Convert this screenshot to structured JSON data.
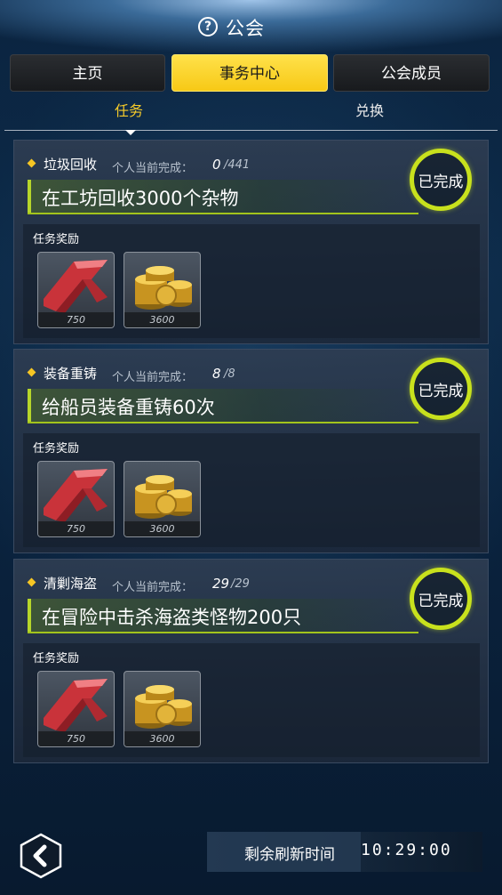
{
  "header": {
    "title": "公会",
    "help_symbol": "?"
  },
  "tabs": [
    {
      "label": "主页",
      "active": false
    },
    {
      "label": "事务中心",
      "active": true
    },
    {
      "label": "公会成员",
      "active": false
    }
  ],
  "subtabs": [
    {
      "label": "任务",
      "active": true
    },
    {
      "label": "兑换",
      "active": false
    }
  ],
  "tasks": [
    {
      "name": "垃圾回收",
      "progress_label": "个人当前完成：",
      "progress_current": "0",
      "progress_total": "/441",
      "description": "在工坊回收3000个杂物",
      "status": "已完成",
      "rewards_label": "任务奖励",
      "rewards": [
        {
          "icon": "red-chevron-icon",
          "count": "750"
        },
        {
          "icon": "gold-coins-icon",
          "count": "3600"
        }
      ]
    },
    {
      "name": "装备重铸",
      "progress_label": "个人当前完成：",
      "progress_current": "8",
      "progress_total": "/8",
      "description": "给船员装备重铸60次",
      "status": "已完成",
      "rewards_label": "任务奖励",
      "rewards": [
        {
          "icon": "red-chevron-icon",
          "count": "750"
        },
        {
          "icon": "gold-coins-icon",
          "count": "3600"
        }
      ]
    },
    {
      "name": "清剿海盗",
      "progress_label": "个人当前完成：",
      "progress_current": "29",
      "progress_total": "/29",
      "description": "在冒险中击杀海盗类怪物200只",
      "status": "已完成",
      "rewards_label": "任务奖励",
      "rewards": [
        {
          "icon": "red-chevron-icon",
          "count": "750"
        },
        {
          "icon": "gold-coins-icon",
          "count": "3600"
        }
      ]
    }
  ],
  "footer": {
    "refresh_label": "剩余刷新时间",
    "refresh_time": "10:29:00",
    "back_icon": "back-chevron-icon"
  },
  "colors": {
    "accent_yellow": "#f6cb2a",
    "complete_ring": "#c8e11d"
  }
}
